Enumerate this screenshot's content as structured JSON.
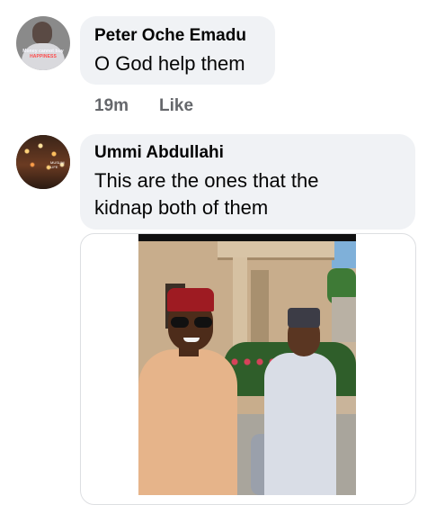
{
  "comments": [
    {
      "author": "Peter Oche Emadu",
      "text": "O God help them",
      "time": "19m",
      "like_label": "Like",
      "avatar_caption_line1": "Money cannot buy",
      "avatar_caption_line2": "HAPPINESS"
    },
    {
      "author": "Ummi Abdullahi",
      "text_line1": "This are the ones that the",
      "text_line2": "kidnap both of them",
      "avatar_caption": "MUSLIM LIFE"
    }
  ],
  "colors": {
    "bubble_bg": "#f0f2f5",
    "meta_text": "#65676b",
    "primary_text": "#050505"
  }
}
